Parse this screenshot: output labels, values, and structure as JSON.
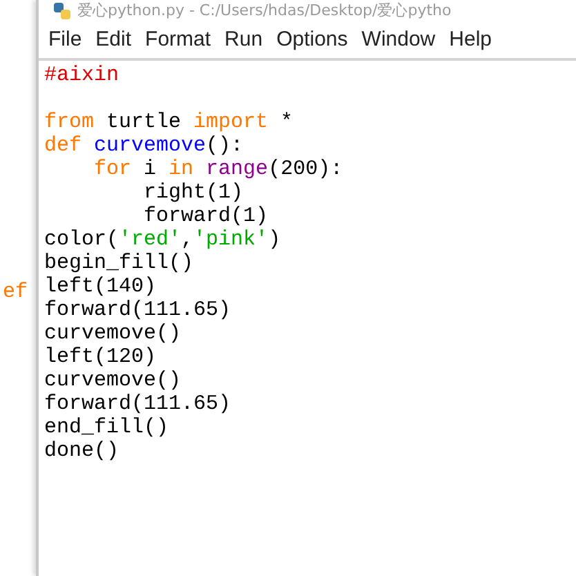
{
  "behind_window": {
    "text": "ef"
  },
  "window": {
    "title": "爱心python.py - C:/Users/hdas/Desktop/爱心pytho"
  },
  "menu": [
    "File",
    "Edit",
    "Format",
    "Run",
    "Options",
    "Window",
    "Help"
  ],
  "editor": {
    "lines": [
      {
        "kind": "code",
        "tokens": [
          {
            "text": "#aixin",
            "kind": "comment"
          }
        ]
      },
      {
        "kind": "blank"
      },
      {
        "kind": "code",
        "tokens": [
          {
            "text": "from",
            "kind": "keyword"
          },
          {
            "text": " turtle ",
            "kind": "plain"
          },
          {
            "text": "import",
            "kind": "keyword"
          },
          {
            "text": " *",
            "kind": "plain"
          }
        ]
      },
      {
        "kind": "code",
        "tokens": [
          {
            "text": "def",
            "kind": "keyword"
          },
          {
            "text": " curvemove",
            "kind": "defname"
          },
          {
            "text": "():",
            "kind": "plain"
          }
        ]
      },
      {
        "kind": "code",
        "tokens": [
          {
            "text": "    for",
            "kind": "keyword"
          },
          {
            "text": " i ",
            "kind": "plain"
          },
          {
            "text": "in",
            "kind": "keyword"
          },
          {
            "text": " range",
            "kind": "builtin"
          },
          {
            "text": "(200):",
            "kind": "plain"
          }
        ]
      },
      {
        "kind": "code",
        "tokens": [
          {
            "text": "        right(1)",
            "kind": "plain"
          }
        ]
      },
      {
        "kind": "code",
        "tokens": [
          {
            "text": "        forward(1)",
            "kind": "plain"
          }
        ]
      },
      {
        "kind": "code",
        "tokens": [
          {
            "text": "color(",
            "kind": "plain"
          },
          {
            "text": "'red'",
            "kind": "string"
          },
          {
            "text": ",",
            "kind": "plain"
          },
          {
            "text": "'pink'",
            "kind": "string"
          },
          {
            "text": ")",
            "kind": "plain"
          }
        ]
      },
      {
        "kind": "code",
        "tokens": [
          {
            "text": "begin_fill()",
            "kind": "plain"
          }
        ]
      },
      {
        "kind": "code",
        "tokens": [
          {
            "text": "left(140)",
            "kind": "plain"
          }
        ]
      },
      {
        "kind": "code",
        "tokens": [
          {
            "text": "forward(111.65)",
            "kind": "plain"
          }
        ]
      },
      {
        "kind": "code",
        "tokens": [
          {
            "text": "curvemove()",
            "kind": "plain"
          }
        ]
      },
      {
        "kind": "code",
        "tokens": [
          {
            "text": "left(120)",
            "kind": "plain"
          }
        ]
      },
      {
        "kind": "code",
        "tokens": [
          {
            "text": "curvemove()",
            "kind": "plain"
          }
        ]
      },
      {
        "kind": "code",
        "tokens": [
          {
            "text": "forward(111.65)",
            "kind": "plain"
          }
        ]
      },
      {
        "kind": "code",
        "tokens": [
          {
            "text": "end_fill()",
            "kind": "plain"
          }
        ]
      },
      {
        "kind": "code",
        "tokens": [
          {
            "text": "done()",
            "kind": "plain"
          }
        ]
      }
    ]
  }
}
